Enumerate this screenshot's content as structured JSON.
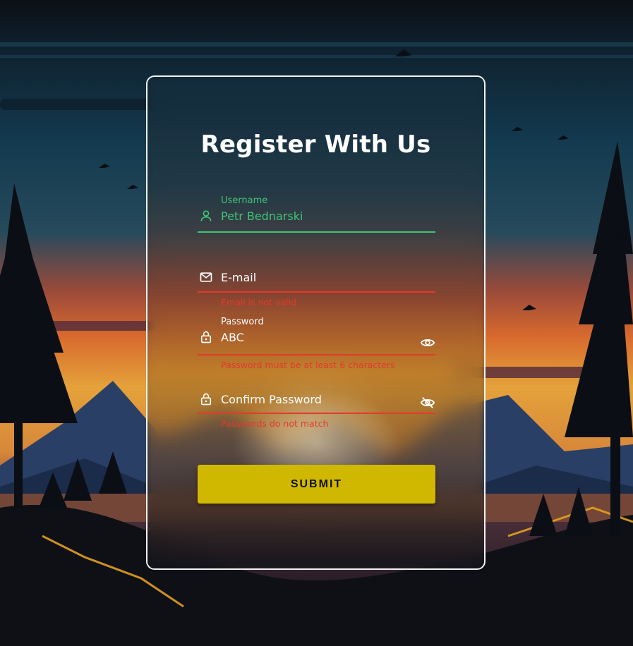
{
  "form": {
    "title": "Register With Us",
    "username": {
      "label": "Username",
      "value": "Petr Bednarski",
      "icon": "user-icon"
    },
    "email": {
      "placeholder": "E-mail",
      "error": "Email is not valid",
      "icon": "mail-icon"
    },
    "password": {
      "label": "Password",
      "value": "ABC",
      "error": "Password must be at least 6 characters",
      "icon": "lock-icon",
      "toggle_icon": "eye-icon"
    },
    "confirm_password": {
      "placeholder": "Confirm Password",
      "error": "Passwords do not match",
      "icon": "lock-icon",
      "toggle_icon": "eye-off-icon"
    },
    "submit_label": "SUBMIT"
  },
  "colors": {
    "valid": "#3fc478",
    "error": "#e23a2e",
    "button": "#d1b800",
    "text": "#ffffff"
  }
}
